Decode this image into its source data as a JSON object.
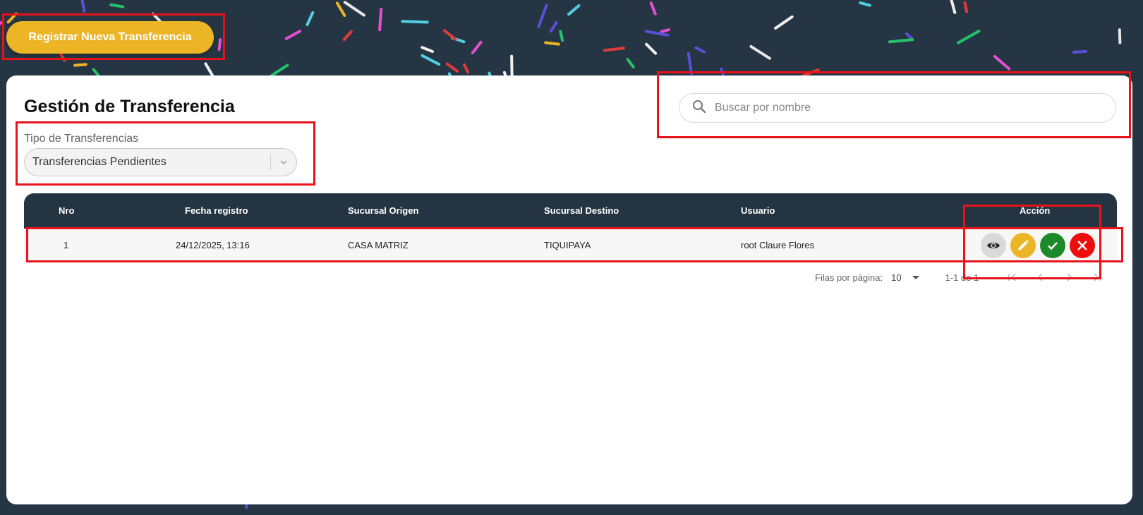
{
  "header": {
    "register_button": "Registrar Nueva Transferencia"
  },
  "page": {
    "title": "Gestión de Transferencia"
  },
  "filter": {
    "label": "Tipo de Transferencias",
    "selected": "Transferencias Pendientes"
  },
  "search": {
    "placeholder": "Buscar por nombre",
    "value": ""
  },
  "table": {
    "headers": [
      "Nro",
      "Fecha registro",
      "Sucursal Origen",
      "Sucursal Destino",
      "Usuario",
      "Acción"
    ],
    "rows": [
      {
        "nro": "1",
        "fecha": "24/12/2025, 13:16",
        "origen": "CASA MATRIZ",
        "destino": "TIQUIPAYA",
        "usuario": "root Claure Flores"
      }
    ],
    "action_icons": [
      "eye-icon",
      "pencil-icon",
      "check-icon",
      "close-icon"
    ]
  },
  "pagination": {
    "rows_label": "Filas por página:",
    "rows_per_page": "10",
    "range": "1-1 de 1"
  },
  "colors": {
    "background": "#263543",
    "accent_yellow": "#ecb526",
    "table_header": "#253442",
    "approve_green": "#1d8a2a",
    "reject_red": "#ee0c0c",
    "annotation_red": "#e8121a"
  }
}
